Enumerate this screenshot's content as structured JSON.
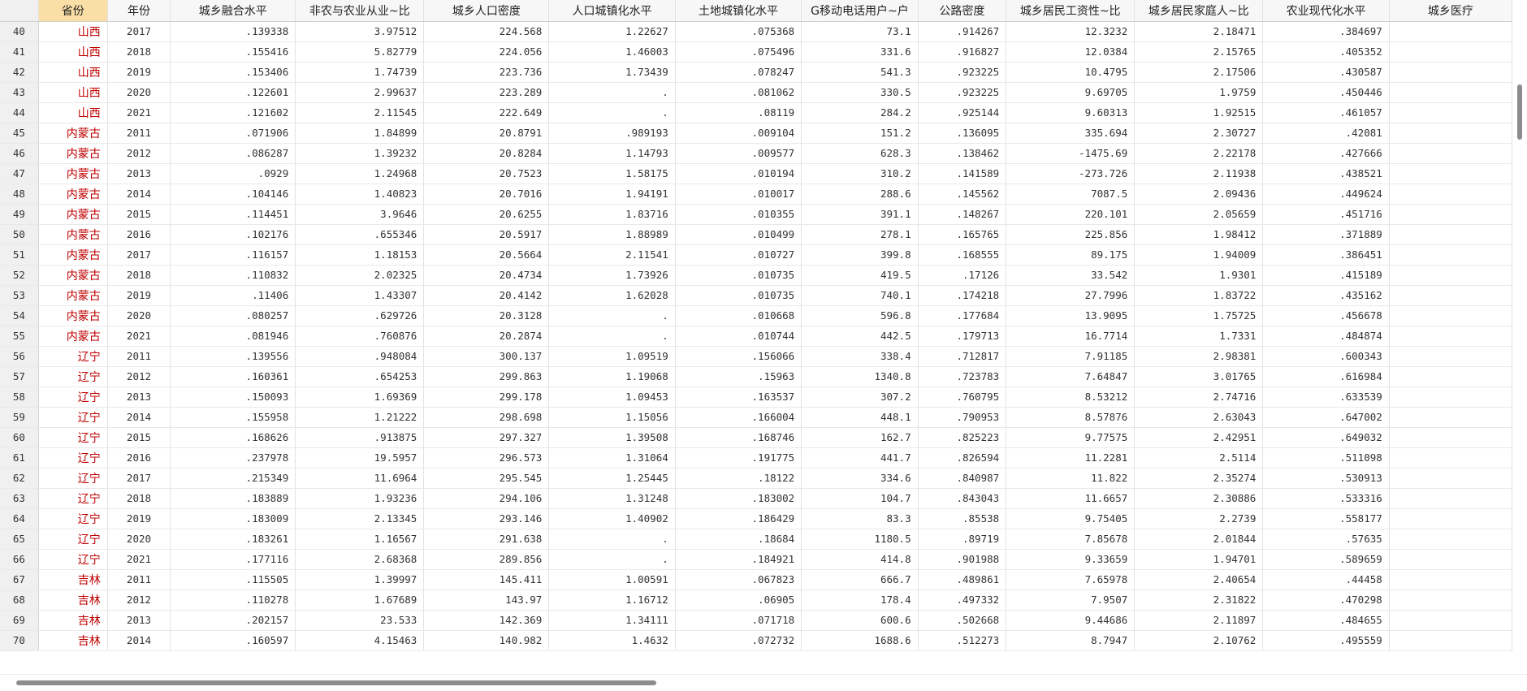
{
  "columns": [
    "",
    "省份",
    "年份",
    "城乡融合水平",
    "非农与农业从业~比",
    "城乡人口密度",
    "人口城镇化水平",
    "土地城镇化水平",
    "G移动电话用户~户",
    "公路密度",
    "城乡居民工资性~比",
    "城乡居民家庭人~比",
    "农业现代化水平",
    "城乡医疗"
  ],
  "rows": [
    [
      "40",
      "山西",
      "2017",
      ".139338",
      "3.97512",
      "224.568",
      "1.22627",
      ".075368",
      "73.1",
      ".914267",
      "12.3232",
      "2.18471",
      ".384697",
      ""
    ],
    [
      "41",
      "山西",
      "2018",
      ".155416",
      "5.82779",
      "224.056",
      "1.46003",
      ".075496",
      "331.6",
      ".916827",
      "12.0384",
      "2.15765",
      ".405352",
      ""
    ],
    [
      "42",
      "山西",
      "2019",
      ".153406",
      "1.74739",
      "223.736",
      "1.73439",
      ".078247",
      "541.3",
      ".923225",
      "10.4795",
      "2.17506",
      ".430587",
      ""
    ],
    [
      "43",
      "山西",
      "2020",
      ".122601",
      "2.99637",
      "223.289",
      ".",
      ".081062",
      "330.5",
      ".923225",
      "9.69705",
      "1.9759",
      ".450446",
      ""
    ],
    [
      "44",
      "山西",
      "2021",
      ".121602",
      "2.11545",
      "222.649",
      ".",
      ".08119",
      "284.2",
      ".925144",
      "9.60313",
      "1.92515",
      ".461057",
      ""
    ],
    [
      "45",
      "内蒙古",
      "2011",
      ".071906",
      "1.84899",
      "20.8791",
      ".989193",
      ".009104",
      "151.2",
      ".136095",
      "335.694",
      "2.30727",
      ".42081",
      ""
    ],
    [
      "46",
      "内蒙古",
      "2012",
      ".086287",
      "1.39232",
      "20.8284",
      "1.14793",
      ".009577",
      "628.3",
      ".138462",
      "-1475.69",
      "2.22178",
      ".427666",
      ""
    ],
    [
      "47",
      "内蒙古",
      "2013",
      ".0929",
      "1.24968",
      "20.7523",
      "1.58175",
      ".010194",
      "310.2",
      ".141589",
      "-273.726",
      "2.11938",
      ".438521",
      ""
    ],
    [
      "48",
      "内蒙古",
      "2014",
      ".104146",
      "1.40823",
      "20.7016",
      "1.94191",
      ".010017",
      "288.6",
      ".145562",
      "7087.5",
      "2.09436",
      ".449624",
      ""
    ],
    [
      "49",
      "内蒙古",
      "2015",
      ".114451",
      "3.9646",
      "20.6255",
      "1.83716",
      ".010355",
      "391.1",
      ".148267",
      "220.101",
      "2.05659",
      ".451716",
      ""
    ],
    [
      "50",
      "内蒙古",
      "2016",
      ".102176",
      ".655346",
      "20.5917",
      "1.88989",
      ".010499",
      "278.1",
      ".165765",
      "225.856",
      "1.98412",
      ".371889",
      ""
    ],
    [
      "51",
      "内蒙古",
      "2017",
      ".116157",
      "1.18153",
      "20.5664",
      "2.11541",
      ".010727",
      "399.8",
      ".168555",
      "89.175",
      "1.94009",
      ".386451",
      ""
    ],
    [
      "52",
      "内蒙古",
      "2018",
      ".110832",
      "2.02325",
      "20.4734",
      "1.73926",
      ".010735",
      "419.5",
      ".17126",
      "33.542",
      "1.9301",
      ".415189",
      ""
    ],
    [
      "53",
      "内蒙古",
      "2019",
      ".11406",
      "1.43307",
      "20.4142",
      "1.62028",
      ".010735",
      "740.1",
      ".174218",
      "27.7996",
      "1.83722",
      ".435162",
      ""
    ],
    [
      "54",
      "内蒙古",
      "2020",
      ".080257",
      ".629726",
      "20.3128",
      ".",
      ".010668",
      "596.8",
      ".177684",
      "13.9095",
      "1.75725",
      ".456678",
      ""
    ],
    [
      "55",
      "内蒙古",
      "2021",
      ".081946",
      ".760876",
      "20.2874",
      ".",
      ".010744",
      "442.5",
      ".179713",
      "16.7714",
      "1.7331",
      ".484874",
      ""
    ],
    [
      "56",
      "辽宁",
      "2011",
      ".139556",
      ".948084",
      "300.137",
      "1.09519",
      ".156066",
      "338.4",
      ".712817",
      "7.91185",
      "2.98381",
      ".600343",
      ""
    ],
    [
      "57",
      "辽宁",
      "2012",
      ".160361",
      ".654253",
      "299.863",
      "1.19068",
      ".15963",
      "1340.8",
      ".723783",
      "7.64847",
      "3.01765",
      ".616984",
      ""
    ],
    [
      "58",
      "辽宁",
      "2013",
      ".150093",
      "1.69369",
      "299.178",
      "1.09453",
      ".163537",
      "307.2",
      ".760795",
      "8.53212",
      "2.74716",
      ".633539",
      ""
    ],
    [
      "59",
      "辽宁",
      "2014",
      ".155958",
      "1.21222",
      "298.698",
      "1.15056",
      ".166004",
      "448.1",
      ".790953",
      "8.57876",
      "2.63043",
      ".647002",
      ""
    ],
    [
      "60",
      "辽宁",
      "2015",
      ".168626",
      ".913875",
      "297.327",
      "1.39508",
      ".168746",
      "162.7",
      ".825223",
      "9.77575",
      "2.42951",
      ".649032",
      ""
    ],
    [
      "61",
      "辽宁",
      "2016",
      ".237978",
      "19.5957",
      "296.573",
      "1.31064",
      ".191775",
      "441.7",
      ".826594",
      "11.2281",
      "2.5114",
      ".511098",
      ""
    ],
    [
      "62",
      "辽宁",
      "2017",
      ".215349",
      "11.6964",
      "295.545",
      "1.25445",
      ".18122",
      "334.6",
      ".840987",
      "11.822",
      "2.35274",
      ".530913",
      ""
    ],
    [
      "63",
      "辽宁",
      "2018",
      ".183889",
      "1.93236",
      "294.106",
      "1.31248",
      ".183002",
      "104.7",
      ".843043",
      "11.6657",
      "2.30886",
      ".533316",
      ""
    ],
    [
      "64",
      "辽宁",
      "2019",
      ".183009",
      "2.13345",
      "293.146",
      "1.40902",
      ".186429",
      "83.3",
      ".85538",
      "9.75405",
      "2.2739",
      ".558177",
      ""
    ],
    [
      "65",
      "辽宁",
      "2020",
      ".183261",
      "1.16567",
      "291.638",
      ".",
      ".18684",
      "1180.5",
      ".89719",
      "7.85678",
      "2.01844",
      ".57635",
      ""
    ],
    [
      "66",
      "辽宁",
      "2021",
      ".177116",
      "2.68368",
      "289.856",
      ".",
      ".184921",
      "414.8",
      ".901988",
      "9.33659",
      "1.94701",
      ".589659",
      ""
    ],
    [
      "67",
      "吉林",
      "2011",
      ".115505",
      "1.39997",
      "145.411",
      "1.00591",
      ".067823",
      "666.7",
      ".489861",
      "7.65978",
      "2.40654",
      ".44458",
      ""
    ],
    [
      "68",
      "吉林",
      "2012",
      ".110278",
      "1.67689",
      "143.97",
      "1.16712",
      ".06905",
      "178.4",
      ".497332",
      "7.9507",
      "2.31822",
      ".470298",
      ""
    ],
    [
      "69",
      "吉林",
      "2013",
      ".202157",
      "23.533",
      "142.369",
      "1.34111",
      ".071718",
      "600.6",
      ".502668",
      "9.44686",
      "2.11897",
      ".484655",
      ""
    ],
    [
      "70",
      "吉林",
      "2014",
      ".160597",
      "4.15463",
      "140.982",
      "1.4632",
      ".072732",
      "1688.6",
      ".512273",
      "8.7947",
      "2.10762",
      ".495559",
      ""
    ]
  ]
}
